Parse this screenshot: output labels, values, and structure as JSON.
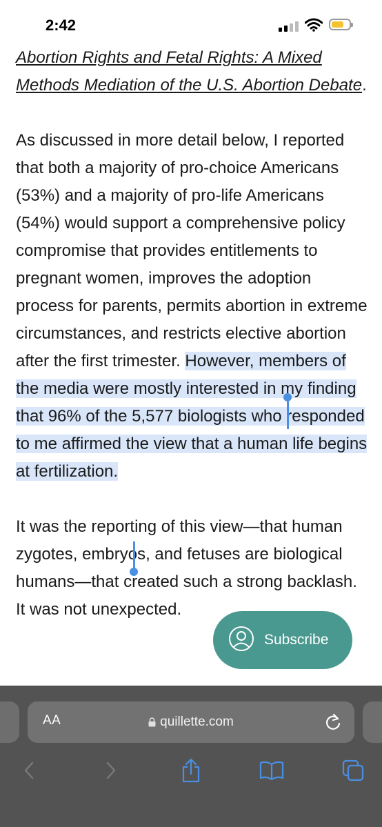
{
  "status_bar": {
    "time": "2:42"
  },
  "article": {
    "citation_title": "Abortion Rights and Fetal Rights: A Mixed Methods Mediation of the U.S. Abortion Debate",
    "citation_end": ".",
    "p2_unselected": "As discussed in more detail below, I reported that both a majority of pro-choice Americans (53%) and a majority of pro-life Americans (54%) would support a comprehensive policy compromise that provides entitlements to pregnant women, improves the adoption process for parents, permits abortion in extreme circumstances, and restricts elective abortion after the first trimester. ",
    "p2_selected": "However, members of the media were mostly interested in my finding that 96% of the 5,577 biologists who responded to me affirmed the view that a human life begins at fertilization.",
    "p3": "It was the reporting of this view—that human zygotes, embryos, and fetuses are biological humans—that created such a strong backlash. It was not unexpected."
  },
  "subscribe": {
    "label": "Subscribe"
  },
  "browser": {
    "aa_label": "AA",
    "url": "quillette.com"
  },
  "colors": {
    "accent": "#4a9990",
    "selection": "#d9e6fa",
    "link_blue": "#4a90e2"
  }
}
